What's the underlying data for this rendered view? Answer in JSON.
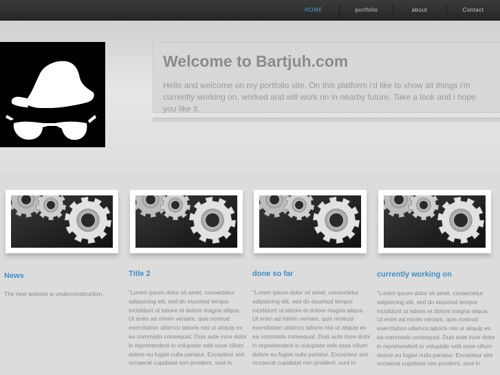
{
  "nav": {
    "items": [
      {
        "label": "HOME",
        "active": true
      },
      {
        "label": "portfolio",
        "active": false
      },
      {
        "label": "about",
        "active": false
      },
      {
        "label": "Contact",
        "active": false
      }
    ]
  },
  "welcome": {
    "title": "Welcome to Bartjuh.com",
    "text": "Hello and welcome on my portfolio site. On this platform i'd like to show all things i'm currently working on, worked and will work on in nearby future. Take a look and i hope you like it."
  },
  "columns": [
    {
      "title": "News",
      "text": "The new website is underconstruction."
    },
    {
      "title": "Title 2",
      "text": "\"Lorem ipsum dolor sit amet, consectetur adipisicing elit, sed do eiusmod tempor incididunt ut labore et dolore magna aliqua. Ut enim ad minim veniam, quis nostrud exercitation ullamco laboris nisi ut aliquip ex ea commodo consequat. Duis aute irure dolor in reprehenderit in voluptate velit esse cillum dolore eu fugiat nulla pariatur. Excepteur sint occaecat cupidatat non proident, sunt in"
    },
    {
      "title": "done so far",
      "text": "\"Lorem ipsum dolor sit amet, consectetur adipisicing elit, sed do eiusmod tempor incididunt ut labore et dolore magna aliqua. Ut enim ad minim veniam, quis nostrud exercitation ullamco laboris nisi ut aliquip ex ea commodo consequat. Duis aute irure dolor in reprehenderit in voluptate velit esse cillum dolore eu fugiat nulla pariatur. Excepteur sint occaecat cupidatat non proident, sunt in"
    },
    {
      "title": "currently working on",
      "text": "\"Lorem ipsum dolor sit amet, consectetur adipisicing elit, sed do eiusmod tempor incididunt ut labore et dolore magna aliqua. Ut enim ad minim veniam, quis nostrud exercitation ullamco laboris nisi ut aliquip ex ea commodo consequat. Duis aute irure dolor in reprehenderit in voluptate velit esse cillum dolore eu fugiat nulla pariatur. Excepteur sint occaecat cupidatat non proident, sunt in"
    }
  ],
  "images": {
    "logo": "spy-hat-sunglasses-logo",
    "thumbnail": "gears-icon"
  },
  "colors": {
    "accent": "#4fa0d8",
    "heading_blue": "#3f8ec7",
    "nav_bg": "#2e2e2e"
  }
}
